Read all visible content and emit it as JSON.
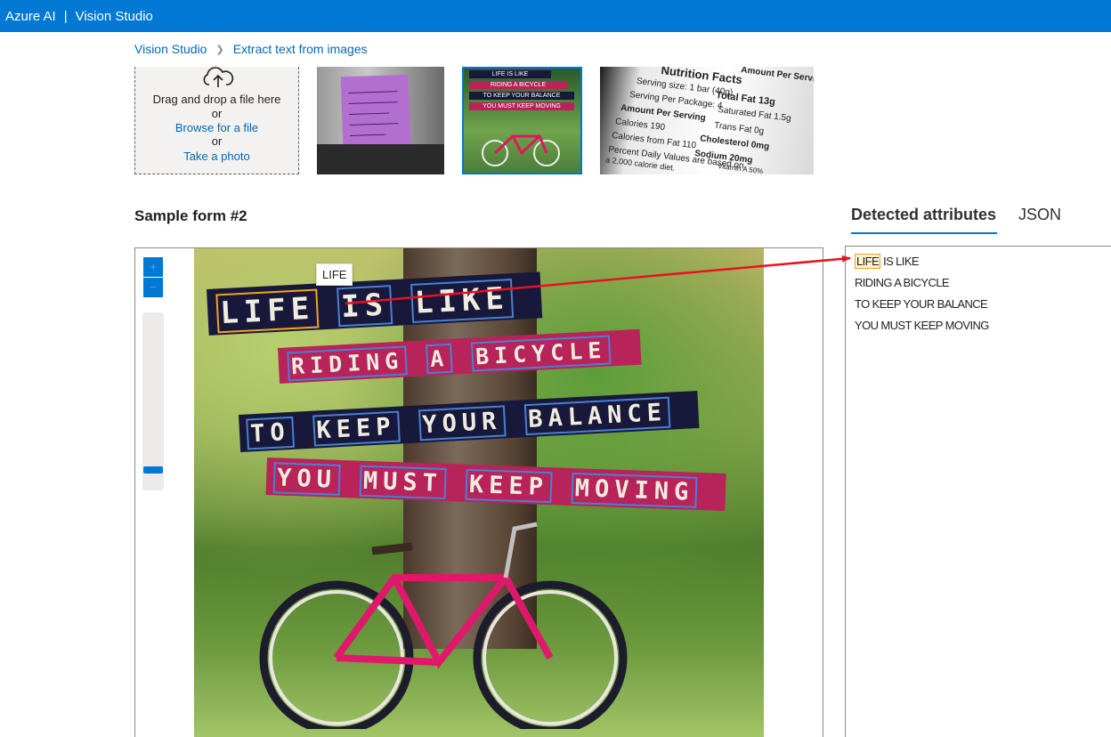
{
  "topbar": {
    "brand": "Azure AI",
    "separator": "|",
    "product": "Vision Studio"
  },
  "breadcrumb": {
    "items": [
      "Vision Studio",
      "Extract text from images"
    ]
  },
  "upload": {
    "drag_text": "Drag and drop a file here",
    "or1": "or",
    "browse_label": "Browse for a file",
    "or2": "or",
    "photo_label": "Take a photo"
  },
  "form_title": "Sample form #2",
  "tabs": {
    "detected": "Detected attributes",
    "json": "JSON"
  },
  "zoom": {
    "plus": "+",
    "minus": "−",
    "level": 0.05
  },
  "tooltip": "LIFE",
  "image_lines": [
    {
      "words": [
        "LIFE",
        "IS",
        "LIKE"
      ]
    },
    {
      "words": [
        "RIDING",
        "A",
        "BICYCLE"
      ]
    },
    {
      "words": [
        "TO",
        "KEEP",
        "YOUR",
        "BALANCE"
      ]
    },
    {
      "words": [
        "YOU",
        "MUST",
        "KEEP",
        "MOVING"
      ]
    }
  ],
  "detected_lines": [
    {
      "highlight": "LIFE",
      "rest": "IS LIKE"
    },
    {
      "text": "RIDING A BICYCLE"
    },
    {
      "text": "TO KEEP YOUR BALANCE"
    },
    {
      "text": "YOU MUST KEEP MOVING"
    }
  ],
  "thumb2_bands": [
    "LIFE IS LIKE",
    "RIDING A BICYCLE",
    "TO KEEP YOUR BALANCE",
    "YOU MUST KEEP MOVING"
  ],
  "thumb3_text": {
    "title": "Nutrition Facts",
    "serving_size": "Serving size: 1 bar (40g)",
    "servings": "Serving Per Package: 4",
    "amount_header": "Amount Per Serving",
    "amount_per_serving": "Amount Per Serving",
    "total_fat": "Total Fat 13g",
    "saturated_fat": "Saturated Fat 1.5g",
    "trans_fat": "Trans Fat 0g",
    "calories": "Calories 190",
    "calories_fat": "Calories from Fat 110",
    "cholesterol": "Cholesterol 0mg",
    "sodium": "Sodium 20mg",
    "daily_values": "Percent Daily Values are based on",
    "calorie_diet": "a 2,000 calorie diet.",
    "vitamin": "Vitamin A 50%"
  },
  "colors": {
    "accent": "#0078d4",
    "link": "#0067b8",
    "selected_box": "#f0a21e",
    "word_box": "#4a7fd4",
    "arrow": "#e81123"
  }
}
